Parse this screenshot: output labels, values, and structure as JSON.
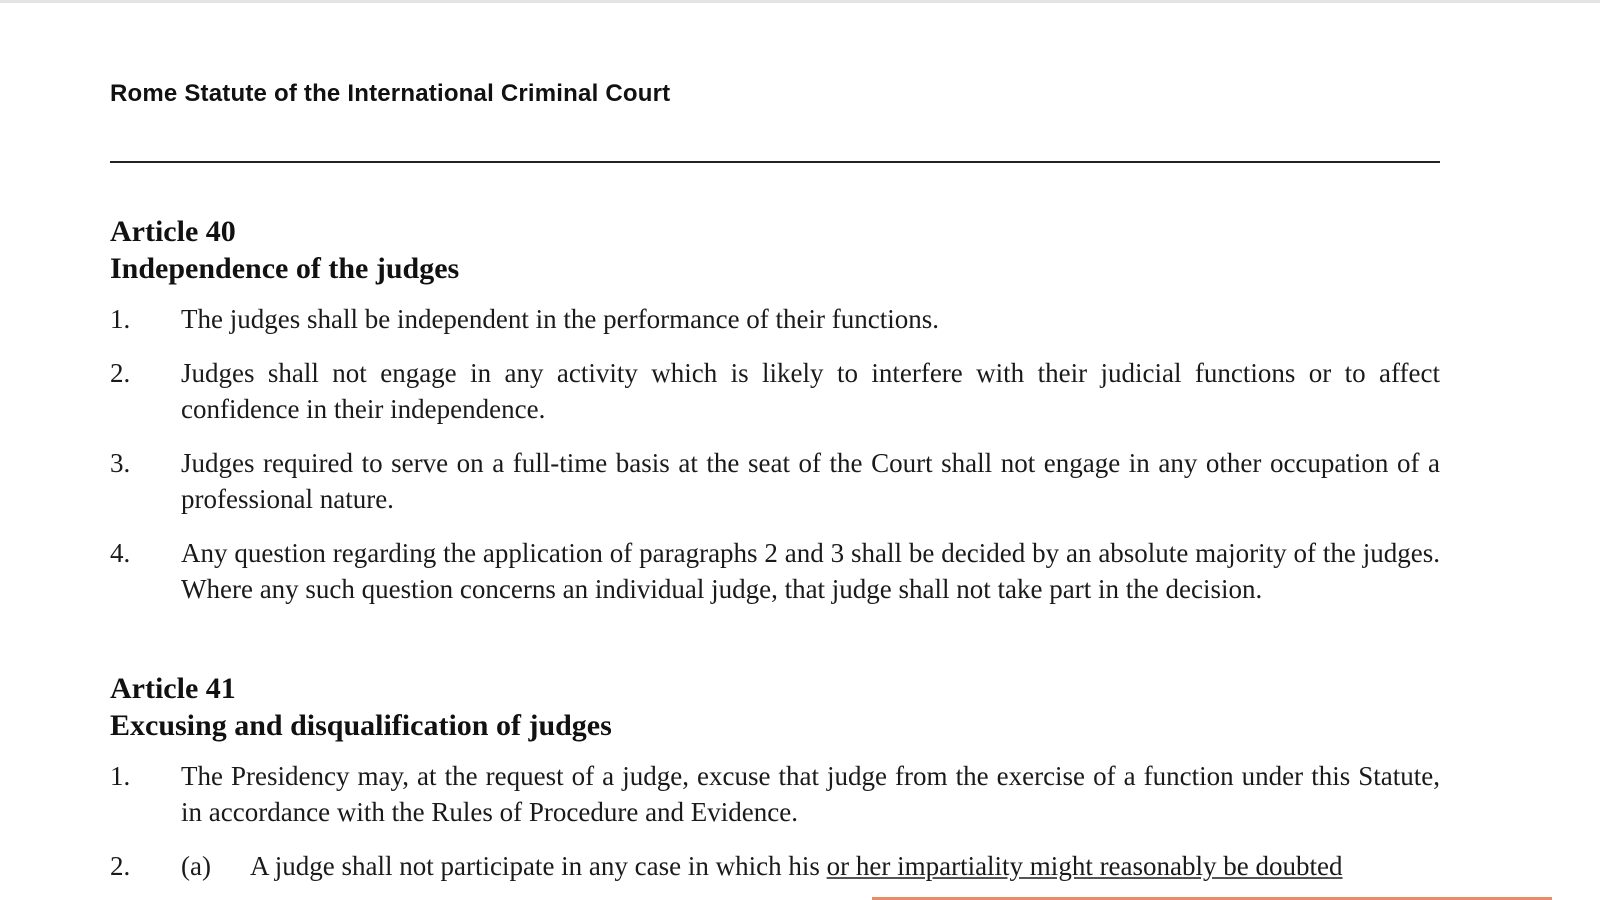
{
  "document": {
    "running_header": "Rome Statute of the International Criminal Court"
  },
  "article40": {
    "number": "Article 40",
    "title": "Independence of the judges",
    "paragraphs": [
      {
        "num": "1.",
        "text": "The judges shall be independent in the performance of their functions."
      },
      {
        "num": "2.",
        "text": "Judges shall not engage in any activity which is likely to interfere with their judicial functions or to affect confidence in their independence."
      },
      {
        "num": "3.",
        "text": "Judges required to serve on a full-time basis at the seat of the Court shall not engage in any other occupation of a professional nature."
      },
      {
        "num": "4.",
        "text": "Any question regarding the application of paragraphs 2 and 3 shall be decided by an absolute majority of the judges. Where any such question concerns an individual judge, that judge shall not take part in the decision."
      }
    ]
  },
  "article41": {
    "number": "Article 41",
    "title": "Excusing and disqualification of judges",
    "paragraphs": [
      {
        "num": "1.",
        "text": "The Presidency may, at the request of a judge, excuse that judge from the exercise of a function under this Statute, in accordance with the Rules of Procedure and Evidence."
      },
      {
        "num": "2.",
        "sub_label": "(a)",
        "text_before": "A judge shall not participate in any case in which his ",
        "text_underlined": "or her impartiality might reasonably be doubted"
      }
    ]
  },
  "colors": {
    "highlight": "#e88c6a"
  }
}
